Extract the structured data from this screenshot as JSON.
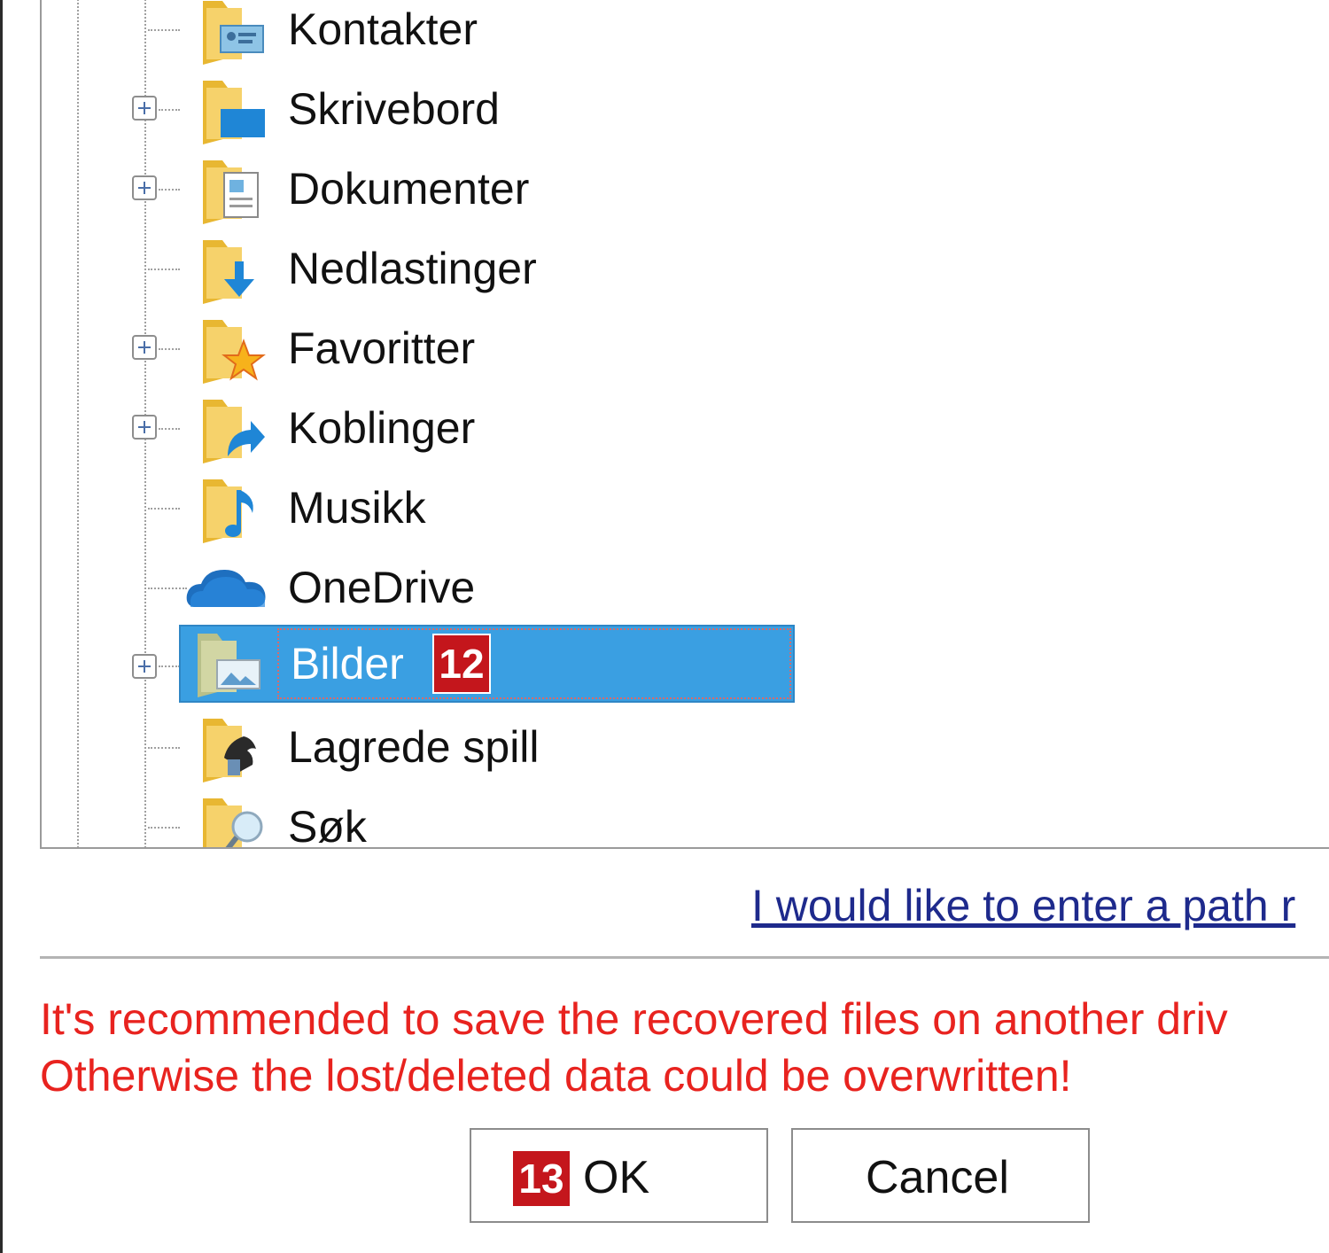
{
  "tree": {
    "items": [
      {
        "label": "Kontakter",
        "expandable": false,
        "icon": "contacts-folder-icon"
      },
      {
        "label": "Skrivebord",
        "expandable": true,
        "icon": "desktop-folder-icon"
      },
      {
        "label": "Dokumenter",
        "expandable": true,
        "icon": "documents-folder-icon"
      },
      {
        "label": "Nedlastinger",
        "expandable": false,
        "icon": "downloads-folder-icon"
      },
      {
        "label": "Favoritter",
        "expandable": true,
        "icon": "favorites-folder-icon"
      },
      {
        "label": "Koblinger",
        "expandable": true,
        "icon": "links-folder-icon"
      },
      {
        "label": "Musikk",
        "expandable": false,
        "icon": "music-folder-icon"
      },
      {
        "label": "OneDrive",
        "expandable": false,
        "icon": "onedrive-cloud-icon"
      },
      {
        "label": "Bilder",
        "expandable": true,
        "icon": "pictures-folder-icon",
        "selected": true,
        "badge": "12"
      },
      {
        "label": "Lagrede spill",
        "expandable": false,
        "icon": "saved-games-folder-icon"
      },
      {
        "label": "Søk",
        "expandable": false,
        "icon": "searches-folder-icon"
      }
    ]
  },
  "path_link": "I would like to enter a path r",
  "warning": {
    "line1": "It's recommended to save the recovered files on another driv",
    "line2": "Otherwise the lost/deleted data could be overwritten!"
  },
  "buttons": {
    "ok_badge": "13",
    "ok_label": "OK",
    "cancel_label": "Cancel"
  },
  "colors": {
    "selection": "#3a9fe2",
    "badge": "#c4161c",
    "warning_text": "#e8231f",
    "link": "#1e2a8c",
    "folder": "#f5c842"
  }
}
